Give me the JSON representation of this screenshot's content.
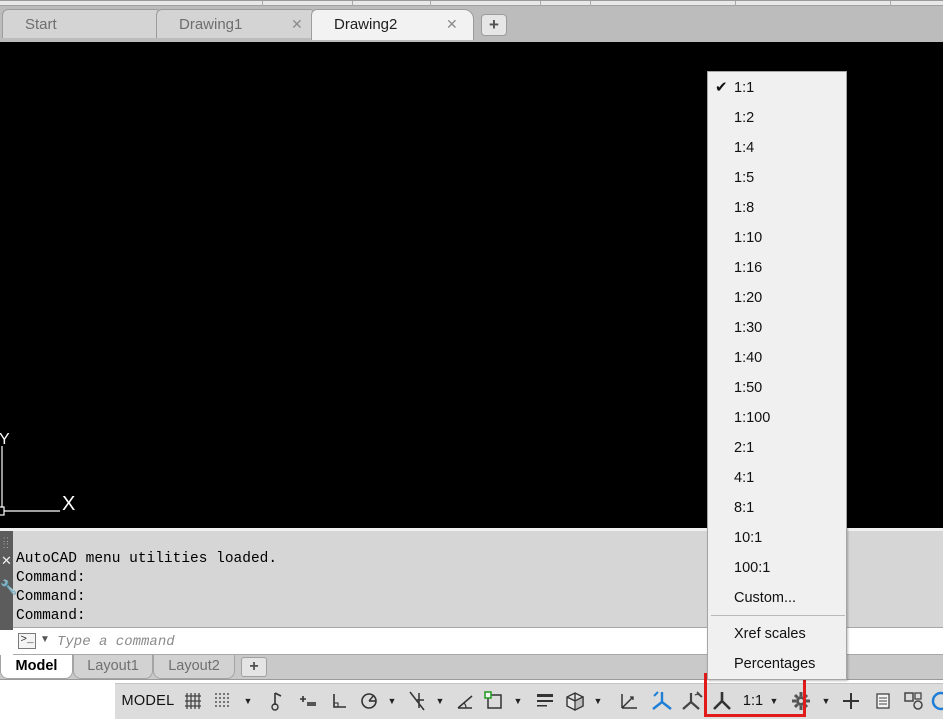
{
  "doc_tabs": [
    {
      "label": "Start"
    },
    {
      "label": "Drawing1"
    },
    {
      "label": "Drawing2"
    }
  ],
  "ucs": {
    "x_label": "X",
    "y_label": "Y"
  },
  "command_history": [
    "AutoCAD menu utilities loaded.",
    "Command:",
    "Command:",
    "Command:"
  ],
  "command_input": {
    "placeholder": "Type a command"
  },
  "layout_tabs": [
    {
      "label": "Model"
    },
    {
      "label": "Layout1"
    },
    {
      "label": "Layout2"
    }
  ],
  "statusbar": {
    "model_label": "MODEL",
    "annotation_scale": "1:1"
  },
  "scale_menu": {
    "selected": "1:1",
    "scales": [
      "1:1",
      "1:2",
      "1:4",
      "1:5",
      "1:8",
      "1:10",
      "1:16",
      "1:20",
      "1:30",
      "1:40",
      "1:50",
      "1:100",
      "2:1",
      "4:1",
      "8:1",
      "10:1",
      "100:1"
    ],
    "custom_label": "Custom...",
    "extra_items": [
      "Xref scales",
      "Percentages"
    ]
  },
  "colors": {
    "canvas": "#000000",
    "highlight": "#e11a1a"
  }
}
